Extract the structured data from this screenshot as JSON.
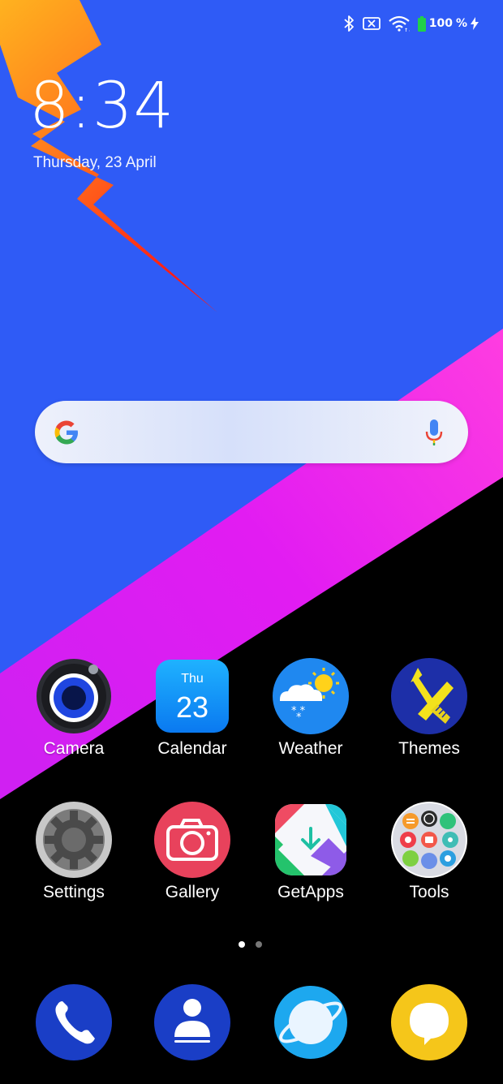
{
  "status_bar": {
    "battery_percent": "100",
    "percent_symbol": "%",
    "icons": [
      "bluetooth-icon",
      "no-sim-icon",
      "wifi-icon",
      "battery-icon",
      "charging-icon"
    ]
  },
  "lock_widget": {
    "time": "8:34",
    "date": "Thursday, 23 April"
  },
  "search": {
    "placeholder": "",
    "icons": [
      "google-g-icon",
      "mic-icon"
    ]
  },
  "apps_row1": [
    {
      "label": "Camera"
    },
    {
      "label": "Calendar",
      "day": "Thu",
      "date": "23"
    },
    {
      "label": "Weather"
    },
    {
      "label": "Themes"
    }
  ],
  "apps_row2": [
    {
      "label": "Settings"
    },
    {
      "label": "Gallery"
    },
    {
      "label": "GetApps"
    },
    {
      "label": "Tools"
    }
  ],
  "page_indicator": {
    "total": 2,
    "active": 1
  },
  "dock": [
    "phone-icon",
    "contacts-icon",
    "browser-icon",
    "messaging-icon"
  ],
  "colors": {
    "wallpaper_blue": "#2f5bf6",
    "wallpaper_magenta": "#e41ef0",
    "wallpaper_black": "#000000",
    "bolt_orange": "#ff7a1a",
    "bolt_red": "#ff2a12"
  }
}
